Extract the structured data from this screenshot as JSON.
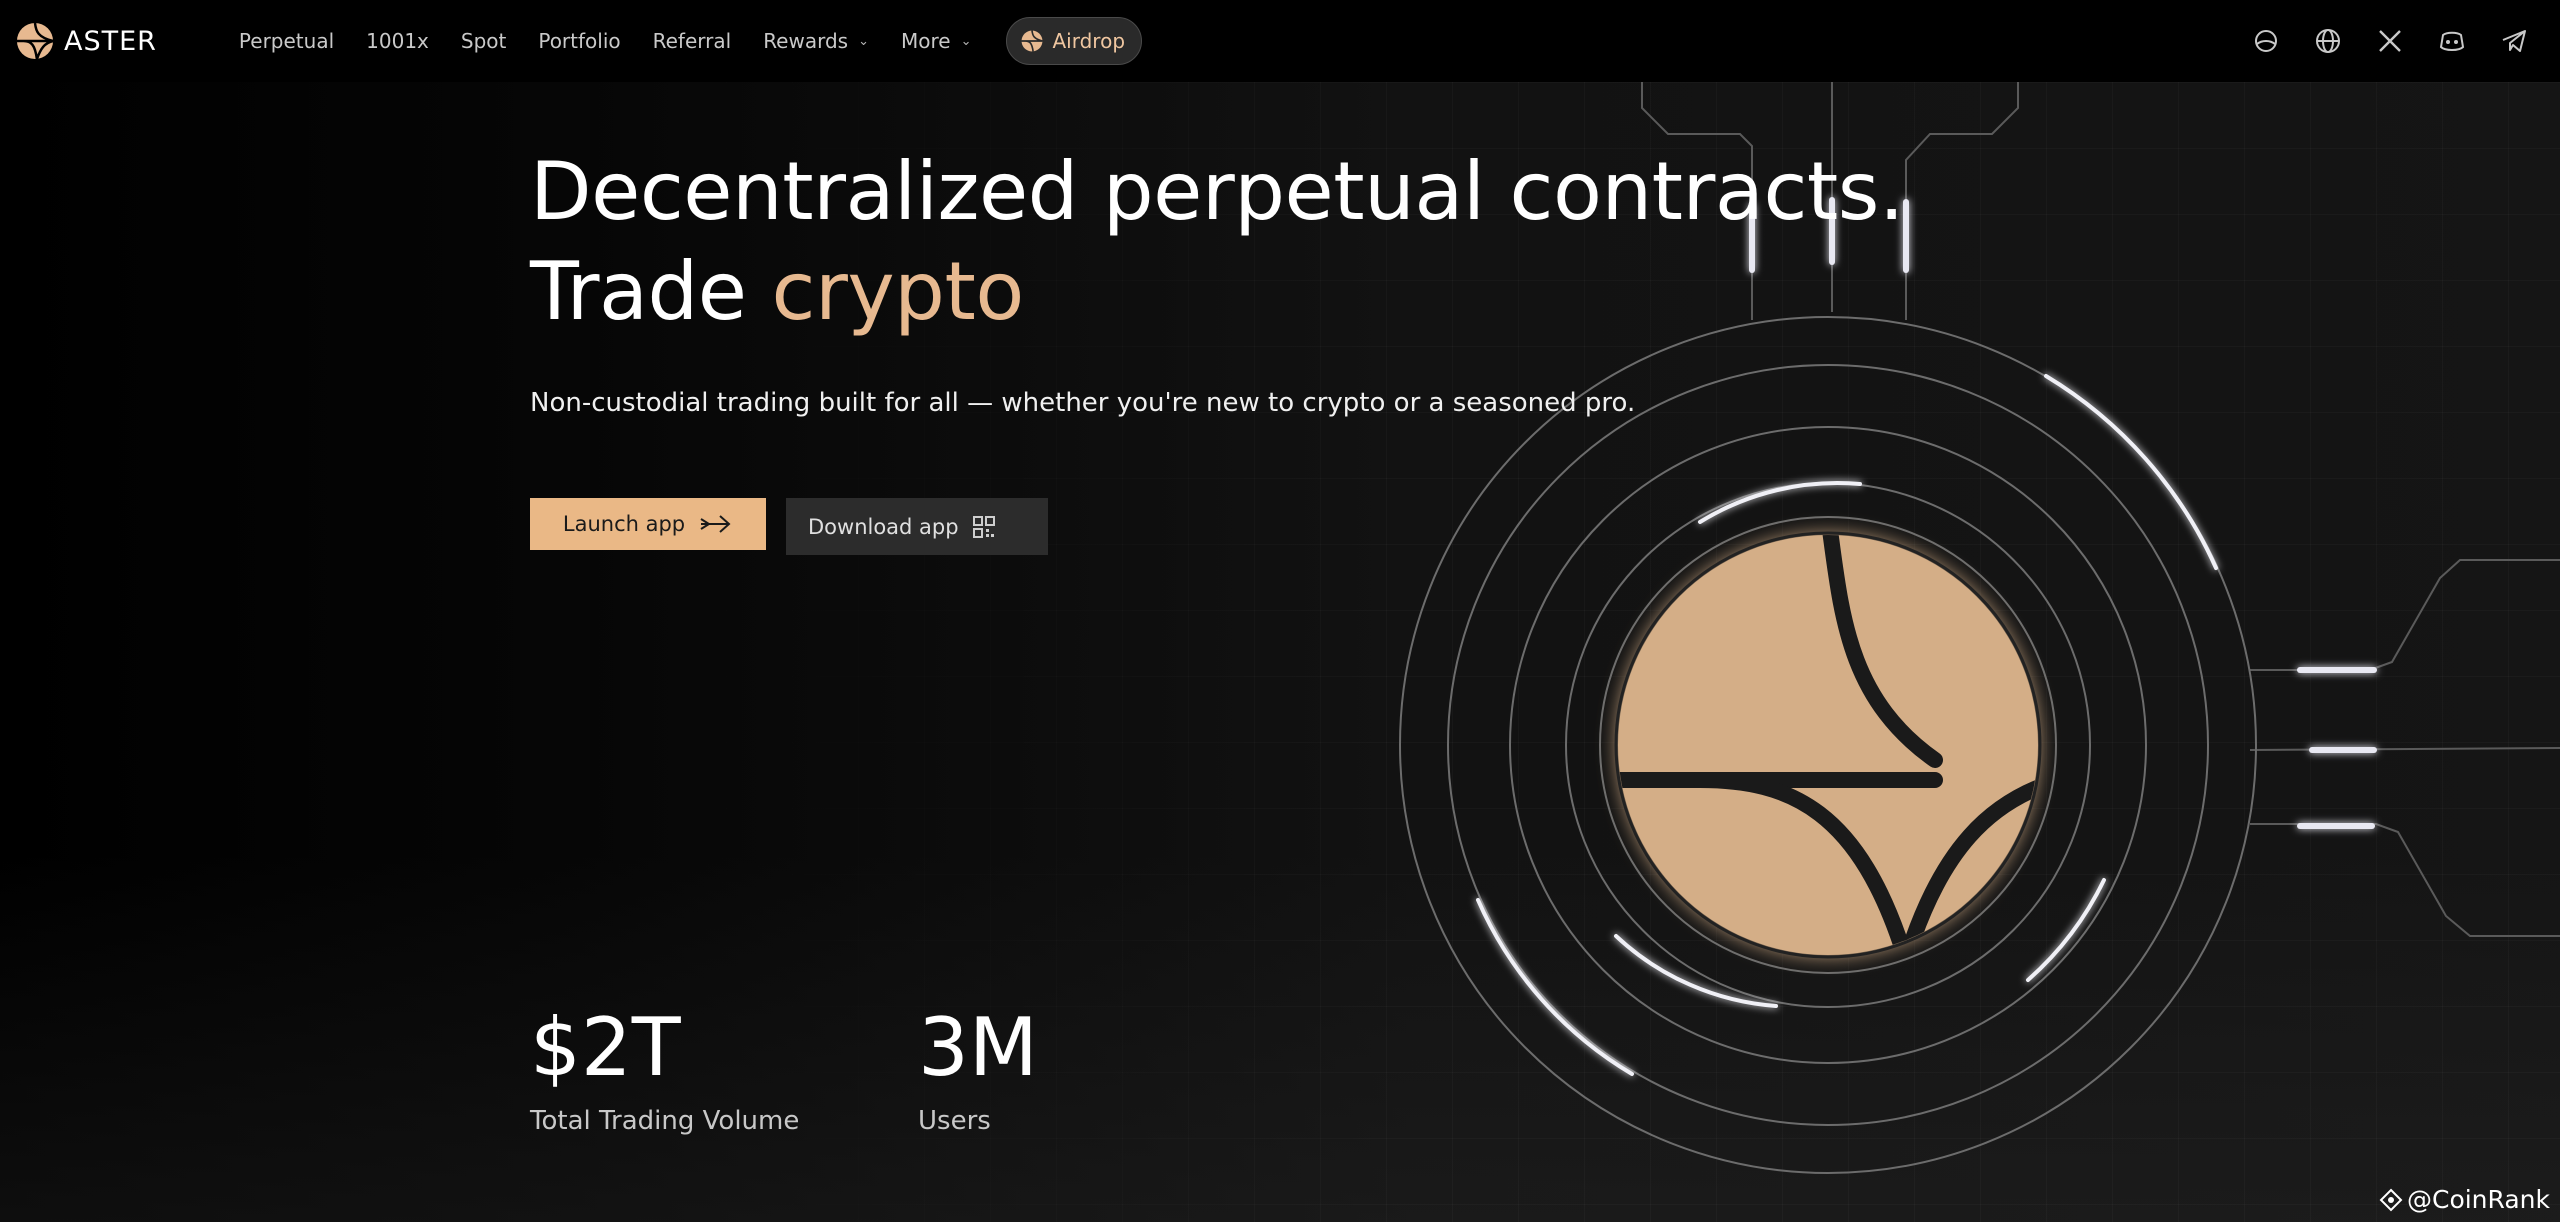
{
  "brand": {
    "name": "ASTER",
    "logo": "aster-star-logo"
  },
  "nav": {
    "items": [
      {
        "label": "Perpetual",
        "dropdown": false
      },
      {
        "label": "1001x",
        "dropdown": false
      },
      {
        "label": "Spot",
        "dropdown": false
      },
      {
        "label": "Portfolio",
        "dropdown": false
      },
      {
        "label": "Referral",
        "dropdown": false
      },
      {
        "label": "Rewards",
        "dropdown": true
      },
      {
        "label": "More",
        "dropdown": true
      }
    ],
    "airdrop_label": "Airdrop",
    "right_icons": [
      "theme-icon",
      "globe-icon",
      "x-icon",
      "discord-icon",
      "telegram-icon"
    ]
  },
  "hero": {
    "title_line1": "Decentralized perpetual contracts.",
    "title_line2_prefix": "Trade ",
    "title_line2_accent": "crypto",
    "subtitle": "Non-custodial trading built for all — whether you're new to crypto or a seasoned pro.",
    "launch_label": "Launch app",
    "download_label": "Download app"
  },
  "stats": [
    {
      "value": "$2T",
      "label": "Total Trading Volume"
    },
    {
      "value": "3M",
      "label": "Users"
    }
  ],
  "watermark": "@CoinRank",
  "colors": {
    "accent": "#e7b990",
    "button": "#eab886",
    "emblem_fill": "#d6b18a",
    "background": "#0c0c0c"
  }
}
